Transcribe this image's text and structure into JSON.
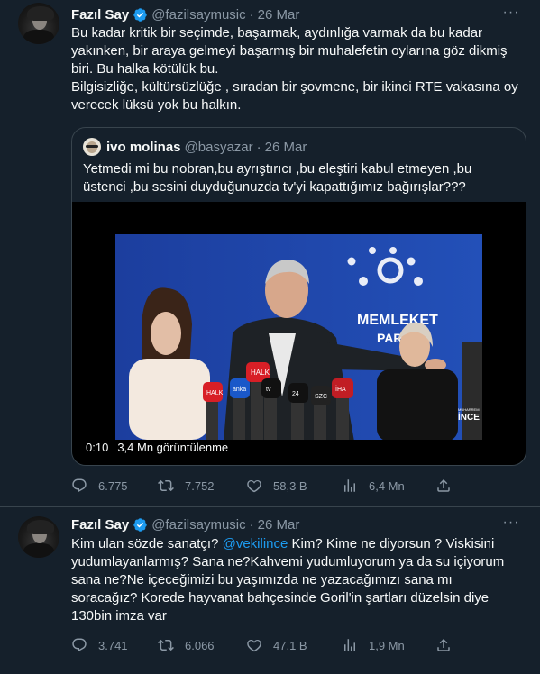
{
  "tweets": [
    {
      "author": {
        "name": "Fazıl Say",
        "handle": "@fazilsaymusic",
        "verified": true
      },
      "dot": "·",
      "date": "26 Mar",
      "text_lines": [
        "Bu kadar kritik bir seçimde, başarmak, aydınlığa varmak da bu kadar yakınken, bir araya gelmeyi başarmış bir muhalefetin oylarına göz dikmiş biri. Bu halka kötülük bu.",
        "Bilgisizliğe, kültürsüzlüğe , sıradan bir şovmene, bir ikinci RTE vakasına oy verecek lüksü yok bu halkın."
      ],
      "quote": {
        "author": {
          "name": "ivo molinas",
          "handle": "@basyazar"
        },
        "date": "26 Mar",
        "text": "Yetmedi mi bu nobran,bu ayrıştırıcı ,bu eleştiri kabul etmeyen ,bu üstenci ,bu sesini duyduğunuzda tv'yi kapattığımız bağırışlar???",
        "video": {
          "elapsed": "0:10",
          "views": "3,4 Mn görüntülenme",
          "backdrop_text_1": "MEMLEKET",
          "backdrop_text_2": "PARTİSİ",
          "watermark_small": "MUHARREM",
          "watermark": "İNCE",
          "mic_labels": [
            "HALK",
            "anka",
            "tv",
            "24",
            "TV",
            "SZC",
            "İHA"
          ]
        }
      },
      "stats": {
        "replies": "6.775",
        "retweets": "7.752",
        "likes": "58,3 B",
        "views": "6,4 Mn"
      }
    },
    {
      "author": {
        "name": "Fazıl Say",
        "handle": "@fazilsaymusic",
        "verified": true
      },
      "dot": "·",
      "date": "26 Mar",
      "text_parts": {
        "pre": "Kim ulan sözde sanatçı? ",
        "mention": "@vekilince",
        "post": " Kim? Kime ne diyorsun ? Viskisini yudumlayanlarmış? Sana ne?Kahvemi yudumluyorum ya da su içiyorum sana ne?Ne içeceğimizi bu yaşımızda ne yazacağımızı sana mı soracağız? Korede hayvanat bahçesinde Goril'in şartları düzelsin diye 130bin imza var"
      },
      "stats": {
        "replies": "3.741",
        "retweets": "6.066",
        "likes": "47,1 B",
        "views": "1,9 Mn"
      }
    }
  ],
  "colors": {
    "background": "#15202b",
    "text": "#f7f9f9",
    "secondary": "#8b98a5",
    "accent": "#1d9bf0",
    "border": "#38444d"
  },
  "icons": [
    "verified-badge-icon",
    "more-icon",
    "reply-icon",
    "retweet-icon",
    "like-icon",
    "views-icon",
    "share-icon"
  ]
}
